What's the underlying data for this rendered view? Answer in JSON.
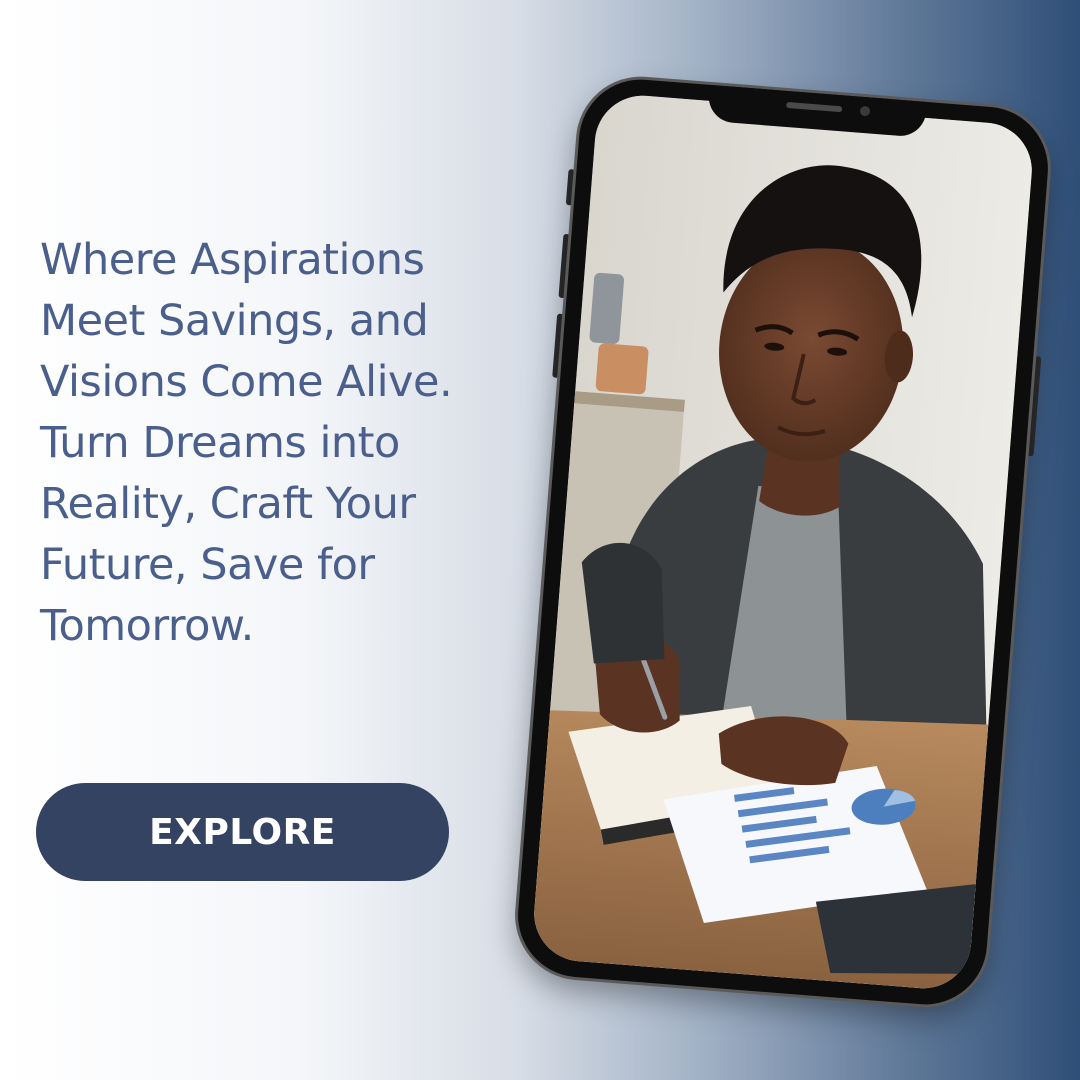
{
  "headline": {
    "lines": [
      "Where Aspirations",
      "Meet Savings, and",
      "Visions Come Alive.",
      "Turn Dreams into",
      "Reality, Craft Your",
      "Future, Save for",
      "Tomorrow."
    ]
  },
  "cta": {
    "label": "EXPLORE"
  },
  "colors": {
    "headline_text": "#4a5f8c",
    "button_bg": "#344361",
    "button_text": "#ffffff",
    "gradient_dark": "#2f4f78"
  }
}
